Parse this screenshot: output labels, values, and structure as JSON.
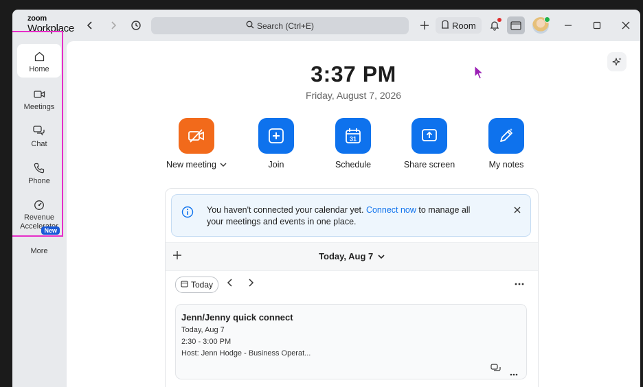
{
  "app": {
    "logo_top": "zoom",
    "logo_bottom": "Workplace"
  },
  "titlebar": {
    "search_placeholder": "Search (Ctrl+E)",
    "room_label": "Room"
  },
  "sidebar": {
    "items": [
      {
        "label": "Home",
        "icon": "home-icon"
      },
      {
        "label": "Meetings",
        "icon": "video-camera-icon"
      },
      {
        "label": "Chat",
        "icon": "chat-bubbles-icon"
      },
      {
        "label": "Phone",
        "icon": "phone-icon"
      },
      {
        "label": "Revenue Accelerator",
        "icon": "gauge-icon"
      }
    ],
    "new_badge": "New",
    "more_label": "More"
  },
  "main": {
    "time": "3:37 PM",
    "date": "Friday, August 7, 2026",
    "actions": [
      {
        "label": "New meeting",
        "icon": "video-off-icon",
        "color": "#f26a1b"
      },
      {
        "label": "Join",
        "icon": "plus-icon",
        "color": "#0e72ed"
      },
      {
        "label": "Schedule",
        "icon": "calendar-icon",
        "color": "#0e72ed",
        "calendar_day": "31"
      },
      {
        "label": "Share screen",
        "icon": "share-up-arrow-icon",
        "color": "#0e72ed"
      },
      {
        "label": "My notes",
        "icon": "notes-pen-icon",
        "color": "#0e72ed"
      }
    ]
  },
  "notice": {
    "text_before": "You haven't connected your calendar yet. ",
    "link": "Connect now",
    "text_after": " to manage all your meetings and events in one place."
  },
  "calendar": {
    "day_label": "Today, Aug 7",
    "today_button": "Today"
  },
  "meeting": {
    "title": "Jenn/Jenny quick connect",
    "date": "Today, Aug 7",
    "time": "2:30 - 3:00 PM",
    "host": "Host: Jenn Hodge - Business Operat..."
  }
}
